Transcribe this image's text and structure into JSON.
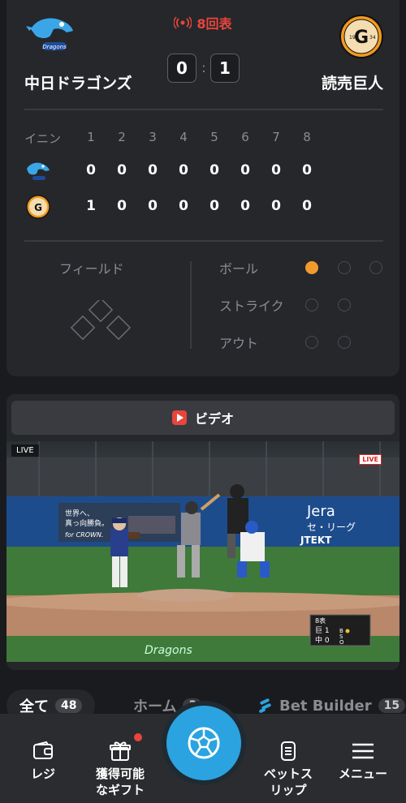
{
  "match": {
    "status": "8回表",
    "home_team": "中日ドラゴンズ",
    "away_team": "読売巨人",
    "home_score": "0",
    "away_score": "1",
    "score_separator": ":"
  },
  "innings": {
    "header_label": "イニン",
    "numbers": [
      "1",
      "2",
      "3",
      "4",
      "5",
      "6",
      "7",
      "8"
    ],
    "home_runs": [
      "0",
      "0",
      "0",
      "0",
      "0",
      "0",
      "0",
      "0"
    ],
    "away_runs": [
      "1",
      "0",
      "0",
      "0",
      "0",
      "0",
      "0",
      "0"
    ]
  },
  "field": {
    "label": "フィールド",
    "ball_label": "ボール",
    "strike_label": "ストライク",
    "out_label": "アウト",
    "balls": 1,
    "strikes": 0,
    "outs": 0
  },
  "video": {
    "tab_label": "ビデオ",
    "live_label": "LIVE",
    "live_badge": "LIVE"
  },
  "filters": [
    {
      "label": "全て",
      "count": "48"
    },
    {
      "label": "ホーム",
      "count": "3"
    },
    {
      "label": "Bet Builder",
      "count": "15"
    }
  ],
  "nav": {
    "cashier": "レジ",
    "gifts_line1": "獲得可能",
    "gifts_line2": "なギフト",
    "betslip_line1": "ベットス",
    "betslip_line2": "リップ",
    "menu": "メニュー"
  },
  "colors": {
    "accent_orange": "#f29a2e",
    "live_red": "#e8453c",
    "center_blue": "#2ba3e0",
    "background": "#1a1b1e",
    "card": "#26272b"
  }
}
